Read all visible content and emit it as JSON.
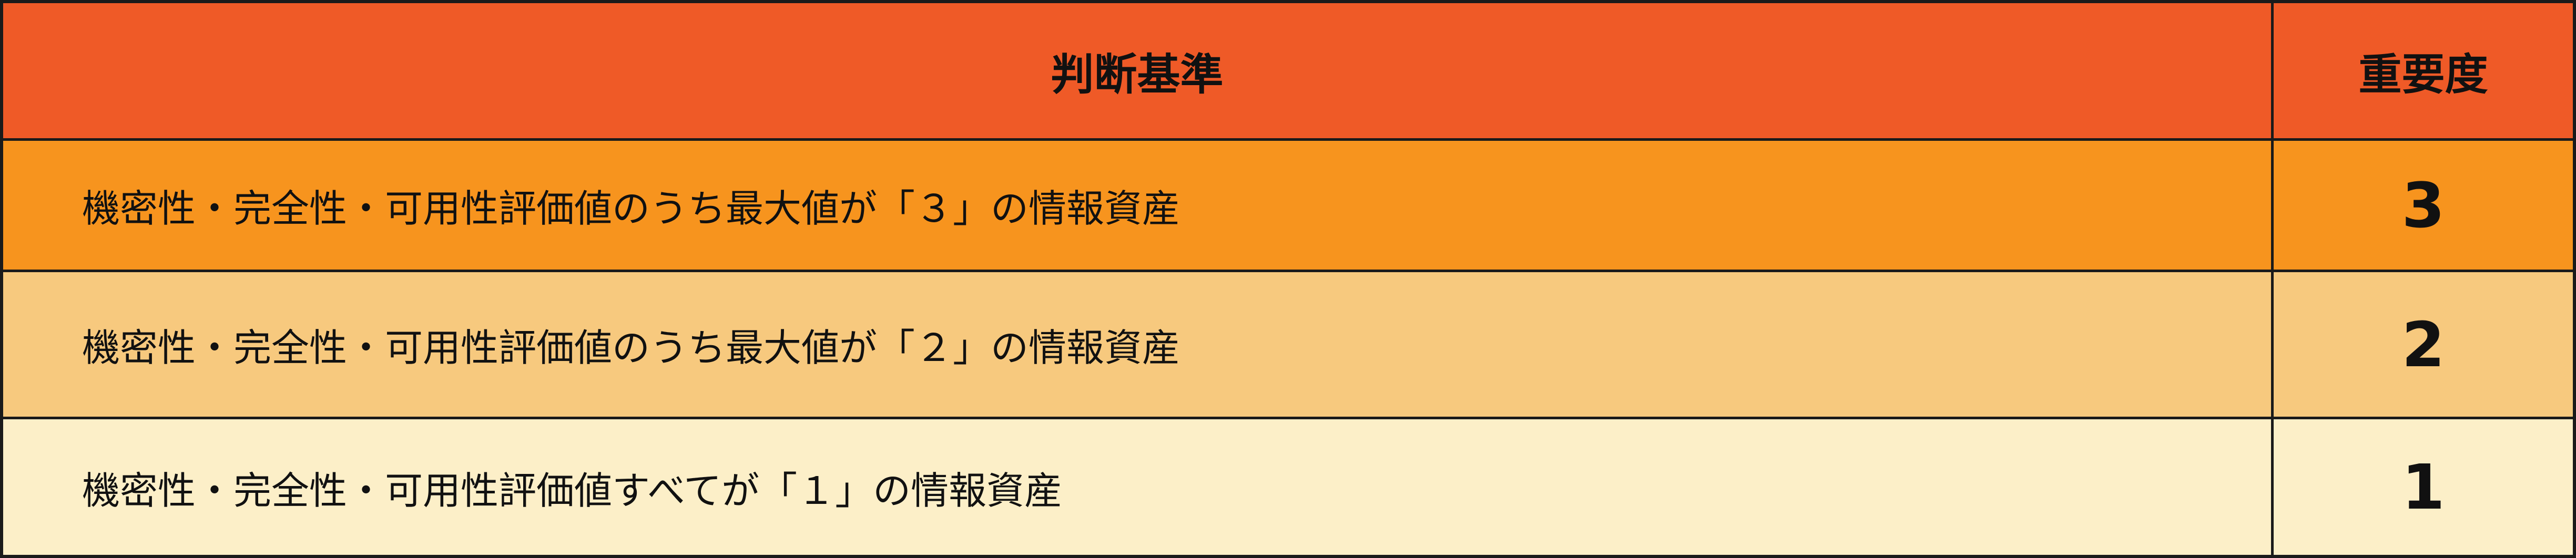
{
  "table": {
    "header": {
      "criteria": "判断基準",
      "importance": "重要度"
    },
    "rows": [
      {
        "criteria": "機密性・完全性・可用性評価値のうち最大値が「３」の情報資産",
        "importance": "3",
        "color": "#f7941e"
      },
      {
        "criteria": "機密性・完全性・可用性評価値のうち最大値が「２」の情報資産",
        "importance": "2",
        "color": "#f7c97e"
      },
      {
        "criteria": "機密性・完全性・可用性評価値すべてが「１」の情報資産",
        "importance": "1",
        "color": "#fcefc8"
      }
    ],
    "header_color": "#ef5a27"
  }
}
